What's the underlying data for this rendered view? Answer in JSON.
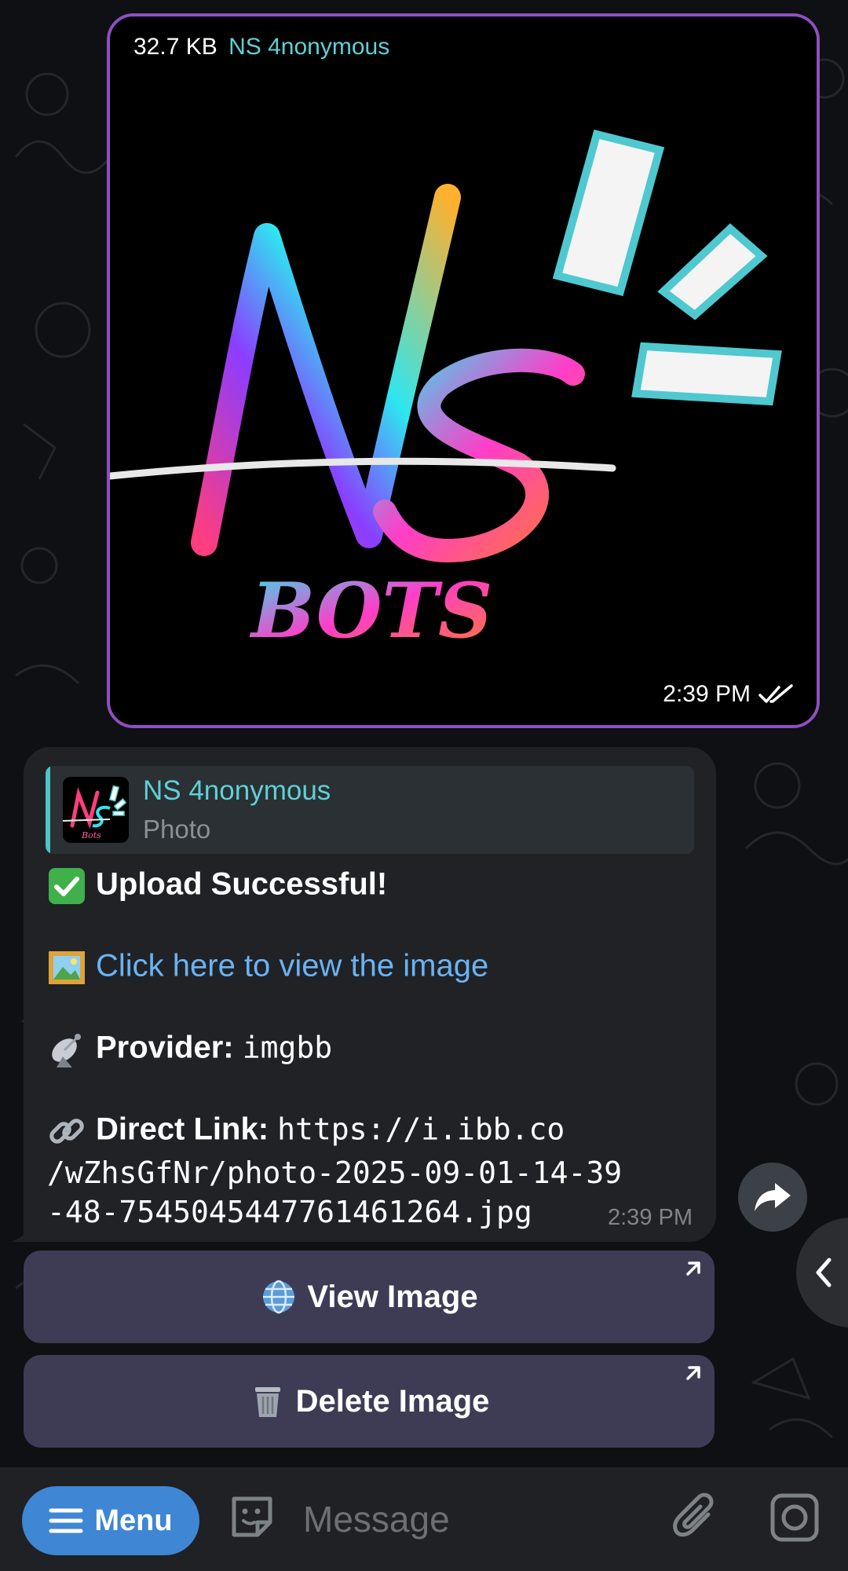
{
  "photo_message": {
    "file_size": "32.7 KB",
    "sender": "NS 4nonymous",
    "time": "2:39 PM",
    "logo_text": "NS BOTS",
    "read_status_icon": "double-check-icon"
  },
  "bot_message": {
    "reply": {
      "name": "NS 4nonymous",
      "type": "Photo"
    },
    "status_text": "Upload Successful!",
    "view_link_text": "Click here to view the image",
    "provider_label": "Provider:",
    "provider_value": "imgbb",
    "direct_link_label": "Direct Link:",
    "direct_link_lines": [
      "https://i.ibb.co",
      "/wZhsGfNr/photo-2025-09-01-14-39",
      "-48-7545045447761461264.jpg"
    ],
    "time": "2:39 PM"
  },
  "keyboard": {
    "view_button": "View Image",
    "delete_button": "Delete Image"
  },
  "input_bar": {
    "menu_label": "Menu",
    "placeholder": "Message"
  },
  "colors": {
    "accent_blue": "#3f86d4",
    "link": "#6ab3f3",
    "sender_teal": "#5fd0d6",
    "photo_border": "#8e4fc2",
    "keyboard_button": "#3e3c55"
  }
}
